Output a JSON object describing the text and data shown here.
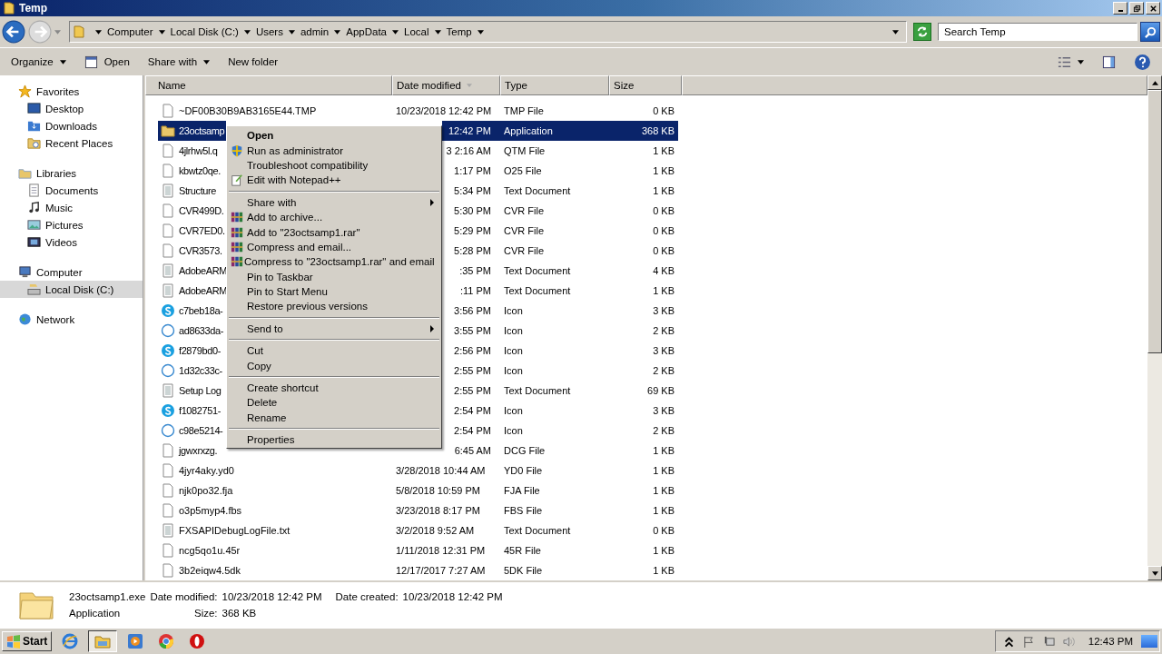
{
  "window": {
    "title": "Temp"
  },
  "address": {
    "crumbs": [
      "Computer",
      "Local Disk (C:)",
      "Users",
      "admin",
      "AppData",
      "Local",
      "Temp"
    ]
  },
  "search": {
    "placeholder": "Search Temp"
  },
  "toolbar": {
    "buttons": [
      {
        "label": "Organize",
        "kind": "menu"
      },
      {
        "label": "Open",
        "kind": "open"
      },
      {
        "label": "Share with",
        "kind": "menu"
      },
      {
        "label": "New folder",
        "kind": "plain"
      }
    ]
  },
  "nav": [
    {
      "label": "Favorites",
      "kind": "star",
      "selected": false,
      "children": [
        {
          "label": "Desktop",
          "kind": "desktop",
          "selected": false
        },
        {
          "label": "Downloads",
          "kind": "downloads",
          "selected": false
        },
        {
          "label": "Recent Places",
          "kind": "recent",
          "selected": false
        }
      ]
    },
    {
      "label": "Libraries",
      "kind": "library",
      "selected": false,
      "children": [
        {
          "label": "Documents",
          "kind": "documents",
          "selected": false
        },
        {
          "label": "Music",
          "kind": "music",
          "selected": false
        },
        {
          "label": "Pictures",
          "kind": "pictures",
          "selected": false
        },
        {
          "label": "Videos",
          "kind": "videos",
          "selected": false
        }
      ]
    },
    {
      "label": "Computer",
      "kind": "computer",
      "selected": false,
      "children": [
        {
          "label": "Local Disk (C:)",
          "kind": "disk",
          "selected": true
        }
      ]
    },
    {
      "label": "Network",
      "kind": "network",
      "selected": false
    }
  ],
  "table": {
    "columns": [
      "Name",
      "Date modified",
      "Type",
      "Size"
    ],
    "rows": [
      {
        "kind": "blank",
        "name": "~DF00B30B9AB3165E44.TMP",
        "date": "10/23/2018 12:42 PM",
        "type": "TMP File",
        "size": "0 KB",
        "selected": false,
        "covered": false
      },
      {
        "kind": "folder",
        "name": "23octsamp",
        "date": "12:42 PM",
        "type": "Application",
        "size": "368 KB",
        "selected": true,
        "covered": true
      },
      {
        "kind": "blank",
        "name": "4jlrhw5l.q",
        "date": "3 2:16 AM",
        "type": "QTM File",
        "size": "1 KB",
        "selected": false,
        "covered": true
      },
      {
        "kind": "blank",
        "name": "kbwtz0qe.",
        "date": "1:17 PM",
        "type": "O25 File",
        "size": "1 KB",
        "selected": false,
        "covered": true
      },
      {
        "kind": "text",
        "name": "Structure",
        "date": "5:34 PM",
        "type": "Text Document",
        "size": "1 KB",
        "selected": false,
        "covered": true
      },
      {
        "kind": "blank",
        "name": "CVR499D.",
        "date": "5:30 PM",
        "type": "CVR File",
        "size": "0 KB",
        "selected": false,
        "covered": true
      },
      {
        "kind": "blank",
        "name": "CVR7ED0.",
        "date": "5:29 PM",
        "type": "CVR File",
        "size": "0 KB",
        "selected": false,
        "covered": true
      },
      {
        "kind": "blank",
        "name": "CVR3573.",
        "date": "5:28 PM",
        "type": "CVR File",
        "size": "0 KB",
        "selected": false,
        "covered": true
      },
      {
        "kind": "text",
        "name": "AdobeARM",
        "date": ":35 PM",
        "type": "Text Document",
        "size": "4 KB",
        "selected": false,
        "covered": true
      },
      {
        "kind": "text",
        "name": "AdobeARM",
        "date": ":11 PM",
        "type": "Text Document",
        "size": "1 KB",
        "selected": false,
        "covered": true
      },
      {
        "kind": "skype",
        "name": "c7beb18a-",
        "date": "3:56 PM",
        "type": "Icon",
        "size": "3 KB",
        "selected": false,
        "covered": true
      },
      {
        "kind": "outline",
        "name": "ad8633da-",
        "date": "3:55 PM",
        "type": "Icon",
        "size": "2 KB",
        "selected": false,
        "covered": true
      },
      {
        "kind": "skype",
        "name": "f2879bd0-",
        "date": "2:56 PM",
        "type": "Icon",
        "size": "3 KB",
        "selected": false,
        "covered": true
      },
      {
        "kind": "outline",
        "name": "1d32c33c-",
        "date": "2:55 PM",
        "type": "Icon",
        "size": "2 KB",
        "selected": false,
        "covered": true
      },
      {
        "kind": "text",
        "name": "Setup Log",
        "date": "2:55 PM",
        "type": "Text Document",
        "size": "69 KB",
        "selected": false,
        "covered": true
      },
      {
        "kind": "skype",
        "name": "f1082751-",
        "date": "2:54 PM",
        "type": "Icon",
        "size": "3 KB",
        "selected": false,
        "covered": true
      },
      {
        "kind": "outline",
        "name": "c98e5214-",
        "date": "2:54 PM",
        "type": "Icon",
        "size": "2 KB",
        "selected": false,
        "covered": true
      },
      {
        "kind": "blank",
        "name": "jgwxrxzg.",
        "date": "6:45 AM",
        "type": "DCG File",
        "size": "1 KB",
        "selected": false,
        "covered": true
      },
      {
        "kind": "blank",
        "name": "4jyr4aky.yd0",
        "date": "3/28/2018 10:44 AM",
        "type": "YD0 File",
        "size": "1 KB",
        "selected": false,
        "covered": false
      },
      {
        "kind": "blank",
        "name": "njk0po32.fja",
        "date": "5/8/2018 10:59 PM",
        "type": "FJA File",
        "size": "1 KB",
        "selected": false,
        "covered": false
      },
      {
        "kind": "blank",
        "name": "o3p5myp4.fbs",
        "date": "3/23/2018 8:17 PM",
        "type": "FBS File",
        "size": "1 KB",
        "selected": false,
        "covered": false
      },
      {
        "kind": "text",
        "name": "FXSAPIDebugLogFile.txt",
        "date": "3/2/2018 9:52 AM",
        "type": "Text Document",
        "size": "0 KB",
        "selected": false,
        "covered": false
      },
      {
        "kind": "blank",
        "name": "ncg5qo1u.45r",
        "date": "1/11/2018 12:31 PM",
        "type": "45R File",
        "size": "1 KB",
        "selected": false,
        "covered": false
      },
      {
        "kind": "blank",
        "name": "3b2eiqw4.5dk",
        "date": "12/17/2017 7:27 AM",
        "type": "5DK File",
        "size": "1 KB",
        "selected": false,
        "covered": false
      }
    ]
  },
  "context_menu": {
    "groups": [
      [
        {
          "label": "Open",
          "kind": "plain",
          "default": true,
          "submenu": false
        },
        {
          "label": "Run as administrator",
          "kind": "shield",
          "default": false,
          "submenu": false
        },
        {
          "label": "Troubleshoot compatibility",
          "kind": "plain",
          "default": false,
          "submenu": false
        },
        {
          "label": "Edit with Notepad++",
          "kind": "notepad",
          "default": false,
          "submenu": false
        }
      ],
      [
        {
          "label": "Share with",
          "kind": "plain",
          "default": false,
          "submenu": true
        },
        {
          "label": "Add to archive...",
          "kind": "archive",
          "default": false,
          "submenu": false
        },
        {
          "label": "Add to \"23octsamp1.rar\"",
          "kind": "archive",
          "default": false,
          "submenu": false
        },
        {
          "label": "Compress and email...",
          "kind": "archive",
          "default": false,
          "submenu": false
        },
        {
          "label": "Compress to \"23octsamp1.rar\" and email",
          "kind": "archive",
          "default": false,
          "submenu": false
        },
        {
          "label": "Pin to Taskbar",
          "kind": "plain",
          "default": false,
          "submenu": false
        },
        {
          "label": "Pin to Start Menu",
          "kind": "plain",
          "default": false,
          "submenu": false
        },
        {
          "label": "Restore previous versions",
          "kind": "plain",
          "default": false,
          "submenu": false
        }
      ],
      [
        {
          "label": "Send to",
          "kind": "plain",
          "default": false,
          "submenu": true
        }
      ],
      [
        {
          "label": "Cut",
          "kind": "plain",
          "default": false,
          "submenu": false
        },
        {
          "label": "Copy",
          "kind": "plain",
          "default": false,
          "submenu": false
        }
      ],
      [
        {
          "label": "Create shortcut",
          "kind": "plain",
          "default": false,
          "submenu": false
        },
        {
          "label": "Delete",
          "kind": "plain",
          "default": false,
          "submenu": false
        },
        {
          "label": "Rename",
          "kind": "plain",
          "default": false,
          "submenu": false
        }
      ],
      [
        {
          "label": "Properties",
          "kind": "plain",
          "default": false,
          "submenu": false
        }
      ]
    ]
  },
  "details": {
    "name": "23octsamp1.exe",
    "type": "Application",
    "fields": [
      {
        "label": "Date modified:",
        "value": "10/23/2018 12:42 PM"
      },
      {
        "label": "Date created:",
        "value": "10/23/2018 12:42 PM"
      },
      {
        "label": "Size:",
        "value": "368 KB"
      }
    ]
  },
  "taskbar": {
    "start": "Start",
    "apps": [
      {
        "kind": "ie",
        "selected": false
      },
      {
        "kind": "explorer",
        "selected": true
      },
      {
        "kind": "media",
        "selected": false
      },
      {
        "kind": "chrome",
        "selected": false
      },
      {
        "kind": "opera",
        "selected": false
      }
    ],
    "clock": "12:43 PM"
  }
}
